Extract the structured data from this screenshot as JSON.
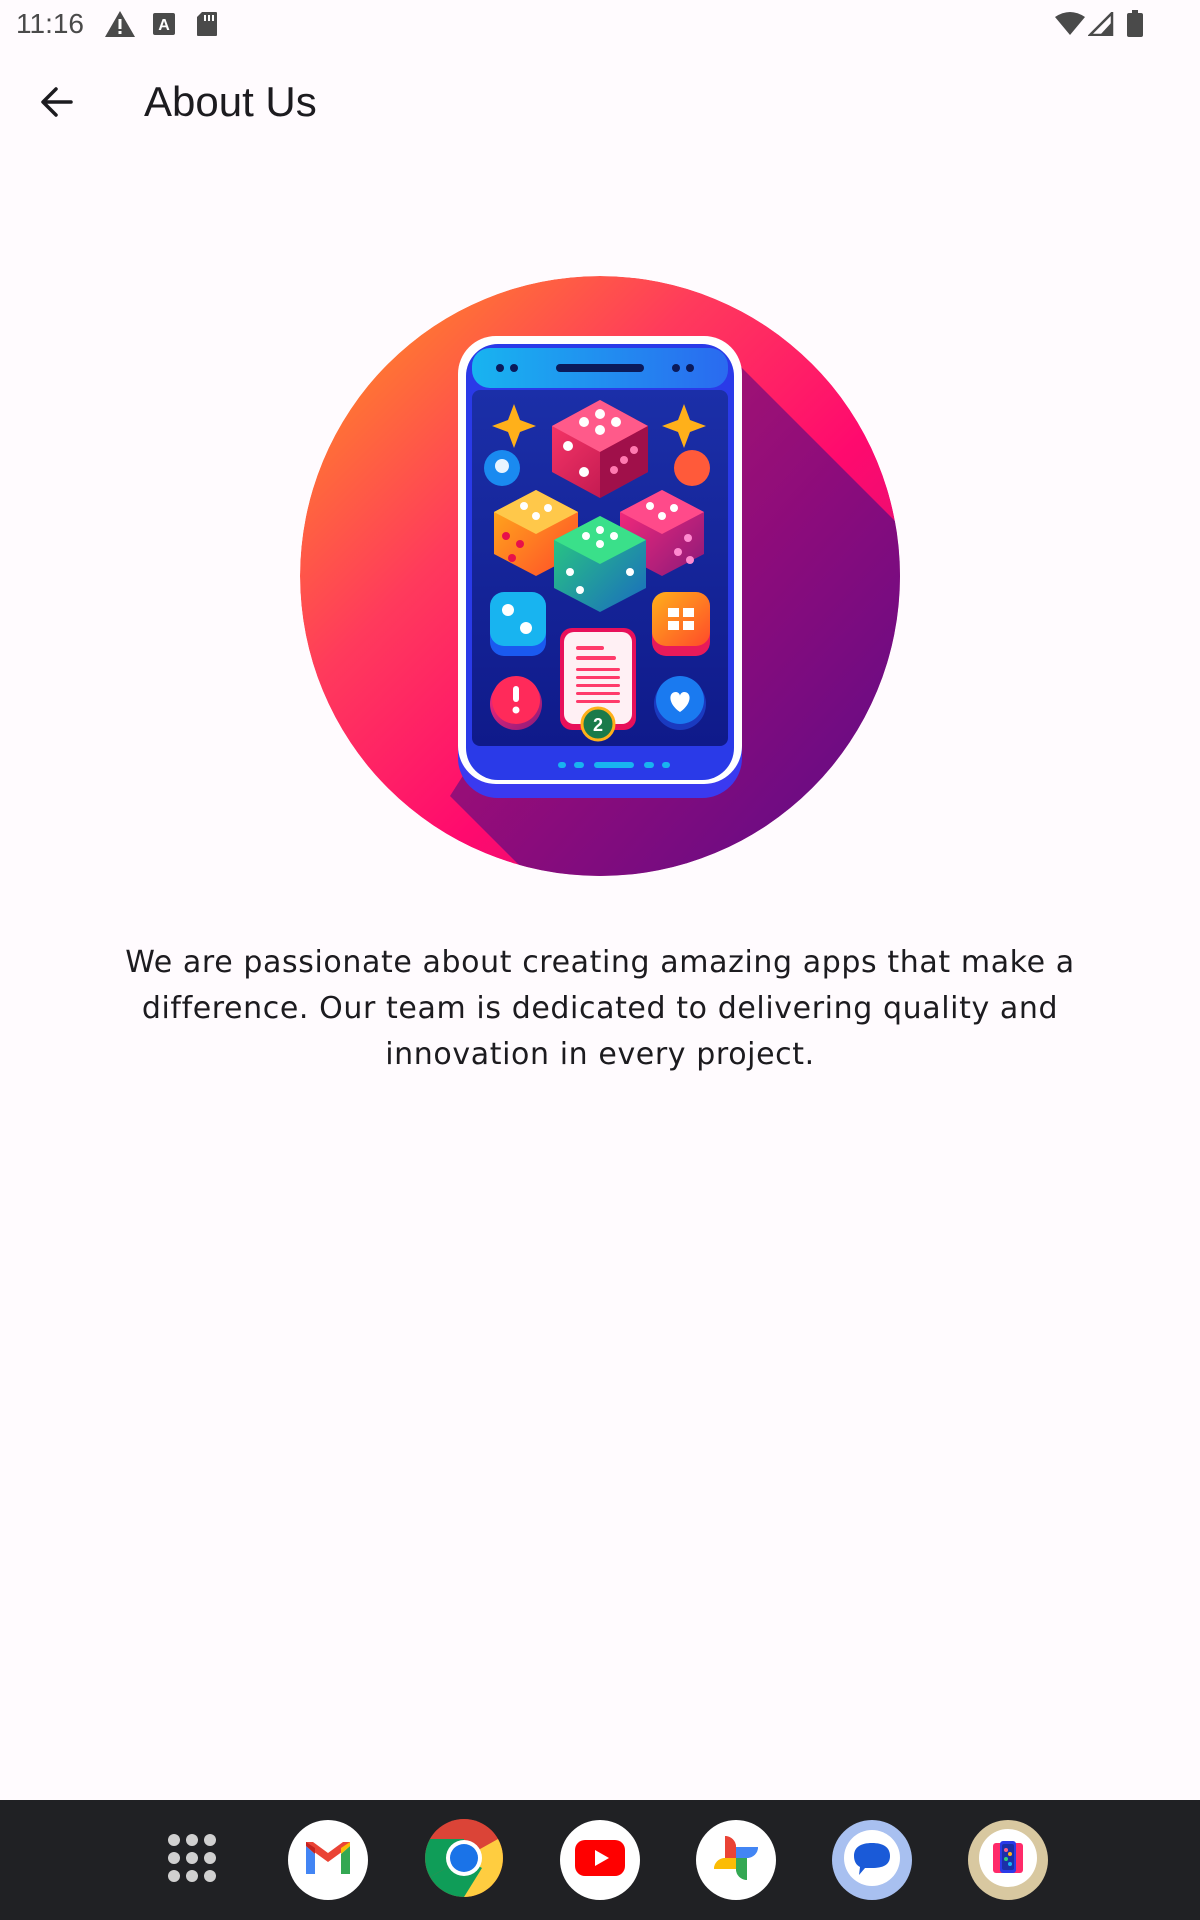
{
  "status_bar": {
    "time": "11:16",
    "left_icons": [
      "warning-icon",
      "text-a-icon",
      "sd-card-icon"
    ],
    "right_icons": [
      "wifi-icon",
      "signal-icon",
      "battery-icon"
    ]
  },
  "app_bar": {
    "back_icon": "arrow-back-icon",
    "title": "About Us"
  },
  "hero": {
    "subject": "dice game app icon",
    "badge_number": "2"
  },
  "about": {
    "text": "We are passionate about creating amazing apps that make a difference. Our team is dedicated to delivering quality and innovation in every project."
  },
  "dock": {
    "items": [
      {
        "icon": "app-drawer-icon"
      },
      {
        "icon": "gmail-icon"
      },
      {
        "icon": "chrome-icon"
      },
      {
        "icon": "youtube-icon"
      },
      {
        "icon": "photos-icon"
      },
      {
        "icon": "messages-icon"
      },
      {
        "icon": "dice-app-icon"
      }
    ]
  },
  "colors": {
    "background": "#fffbfe",
    "text": "#1c1b1f",
    "dock": "#202124",
    "hero_gradient": [
      "#ff8a1e",
      "#ff1f6a",
      "#7a0fa8"
    ],
    "phone_body": "#2b3cf0"
  }
}
